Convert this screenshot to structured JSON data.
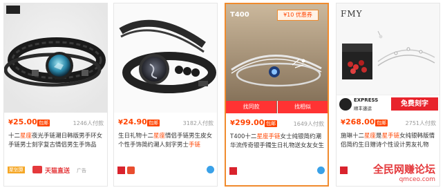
{
  "cards": [
    {
      "price_symbol": "¥",
      "price": "25.00",
      "badge": "包邮",
      "pay_count": "1246人付款",
      "title_parts": [
        "十二",
        "星座",
        "夜光",
        "手链",
        "潮日韩版男手环女手",
        "链",
        "男士刻字复古情侣男生手饰品"
      ],
      "footer": {
        "tag1": "聚划算",
        "tag2": "天猫直送",
        "tag3": "广告"
      }
    },
    {
      "price_symbol": "¥",
      "price": "24.90",
      "badge": "包邮",
      "pay_count": "3182人付款",
      "title_parts": [
        "生日礼物",
        "十二",
        "星座",
        "情侣",
        "手链",
        "男生皮女个性手饰简约潮人刻字男士",
        "手链"
      ]
    },
    {
      "price_symbol": "¥",
      "price": "299.00",
      "badge": "包邮",
      "pay_count": "1649人付款",
      "title_parts": [
        "T400",
        "十二",
        "星座",
        "手链",
        "女士纯银简约潮华流传奇银手镯生日礼物送女友女生"
      ],
      "brand": "T400",
      "coupon": "¥10 优惠券",
      "btn_left": "找同款",
      "btn_right": "找相似"
    },
    {
      "price_symbol": "¥",
      "price": "268.00",
      "badge": "包邮",
      "pay_count": "2751人付款",
      "title_parts": [
        "施琳",
        "十二",
        "星座",
        "是",
        "星",
        "手链",
        "女纯银",
        "韩版情侣简约生日赠诗个性设计男友礼物"
      ],
      "brand": "FMY",
      "express_brand": "EXPRESS",
      "express_sub": "顺丰速运",
      "engrave": "免费刻字"
    }
  ],
  "watermark": {
    "title": "全民网赚论坛",
    "url": "qmceo.com"
  },
  "colors": {
    "accent": "#ff4400",
    "border_highlight": "#f08a2c"
  }
}
